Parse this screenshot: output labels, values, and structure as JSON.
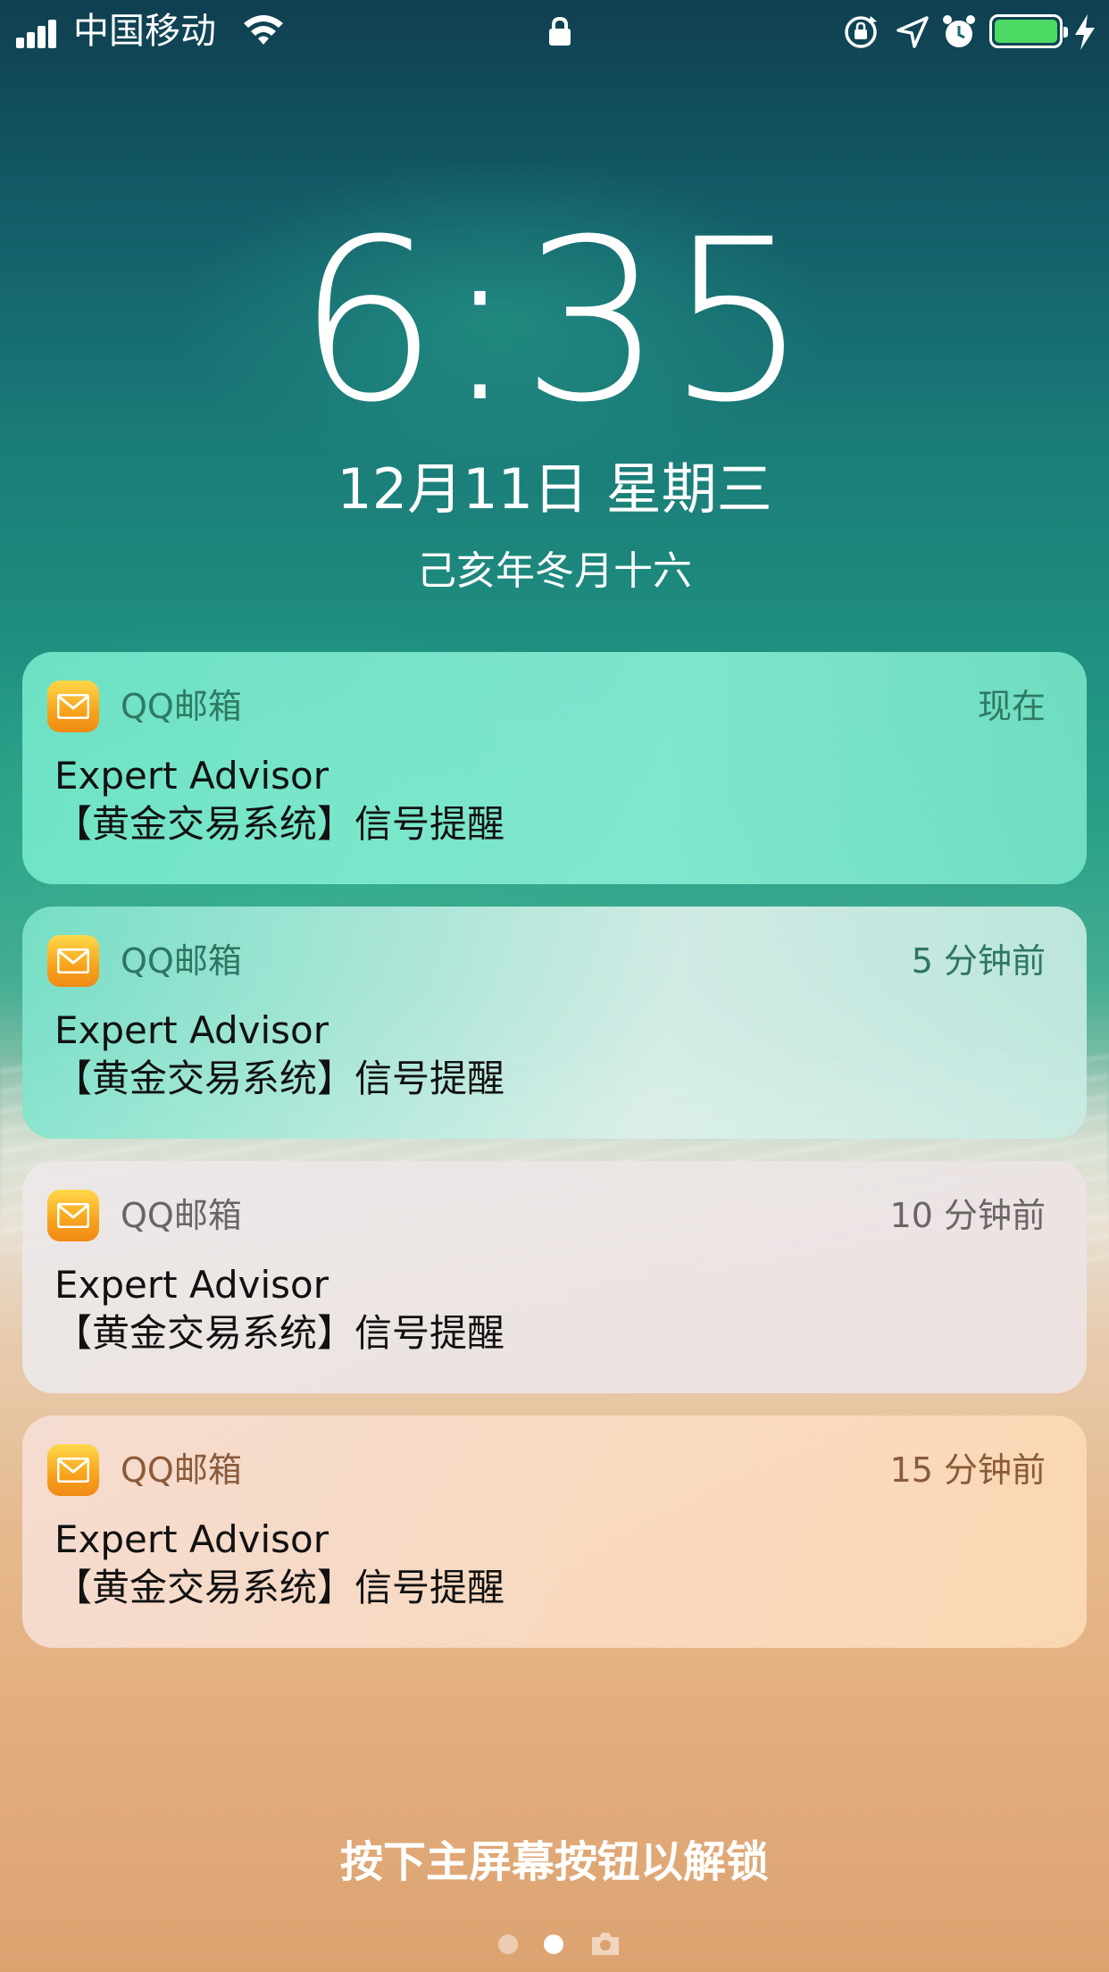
{
  "status_bar": {
    "carrier": "中国移动",
    "battery_level": 1.0,
    "battery_color": "#4cd964",
    "icons": [
      "signal-icon",
      "wifi-icon",
      "lock-icon",
      "orientation-lock-icon",
      "location-icon",
      "alarm-icon",
      "battery-icon",
      "charging-bolt-icon"
    ]
  },
  "lockscreen": {
    "time": "6:35",
    "date": "12月11日 星期三",
    "lunar_date": "己亥年冬月十六",
    "unlock_hint": "按下主屏幕按钮以解锁"
  },
  "notifications": [
    {
      "app": "QQ邮箱",
      "time": "现在",
      "title": "Expert Advisor",
      "body": "【黄金交易系统】信号提醒"
    },
    {
      "app": "QQ邮箱",
      "time": "5 分钟前",
      "title": "Expert Advisor",
      "body": "【黄金交易系统】信号提醒"
    },
    {
      "app": "QQ邮箱",
      "time": "10 分钟前",
      "title": "Expert Advisor",
      "body": "【黄金交易系统】信号提醒"
    },
    {
      "app": "QQ邮箱",
      "time": "15 分钟前",
      "title": "Expert Advisor",
      "body": "【黄金交易系统】信号提醒"
    }
  ],
  "pager": {
    "pages": 3,
    "current": 2
  }
}
